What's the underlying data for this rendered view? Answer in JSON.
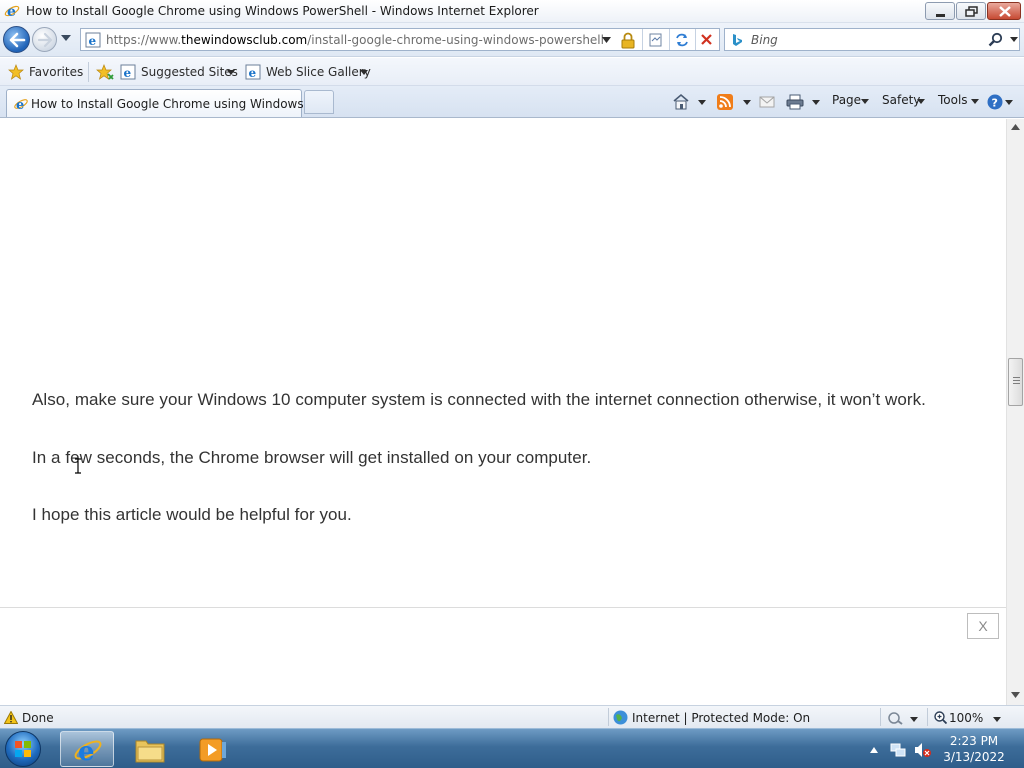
{
  "window": {
    "title": "How to Install Google Chrome using Windows PowerShell - Windows Internet Explorer"
  },
  "address_bar": {
    "url_prefix": "https://www.",
    "url_domain": "thewindowsclub.com",
    "url_path": "/install-google-chrome-using-windows-powershell"
  },
  "search": {
    "placeholder": "Bing"
  },
  "favorites_bar": {
    "favorites_label": "Favorites",
    "suggested_sites_label": "Suggested Sites",
    "web_slice_gallery_label": "Web Slice Gallery"
  },
  "tabs": [
    {
      "label": "How to Install Google Chrome using Windows P...",
      "active": true
    }
  ],
  "command_bar": {
    "page_label": "Page",
    "safety_label": "Safety",
    "tools_label": "Tools"
  },
  "article": {
    "paragraphs": [
      "Also, make sure your Windows 10 computer system is connected with the internet connection otherwise, it won’t work.",
      "In a few seconds, the Chrome browser will get installed on your computer.",
      "I hope this article would be helpful for you."
    ],
    "ad_close_label": "X"
  },
  "status_bar": {
    "status_text": "Done",
    "zone_text": "Internet | Protected Mode: On",
    "zoom": "100%"
  },
  "taskbar": {
    "time": "2:23 PM",
    "date": "3/13/2022"
  },
  "colors": {
    "ie_blue": "#1f62b7",
    "close_red": "#c74a33",
    "taskbar": "#3d6d9a",
    "article_text": "#333333"
  }
}
